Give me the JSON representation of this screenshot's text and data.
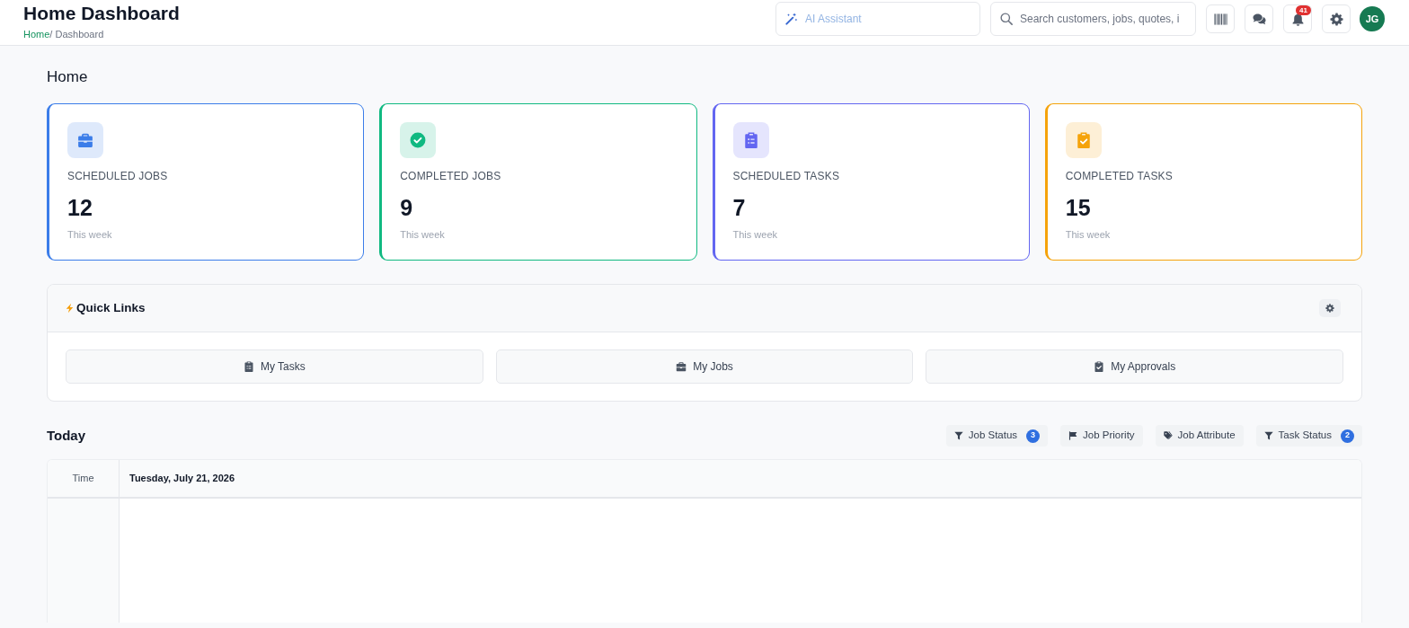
{
  "header": {
    "title": "Home Dashboard",
    "breadcrumb": {
      "link": "Home",
      "current": "/ Dashboard"
    },
    "ai_assistant": {
      "placeholder": "AI Assistant"
    },
    "search": {
      "placeholder": "Search customers, jobs, quotes, i"
    },
    "toolbar_buttons": [
      {
        "kind": "barcode"
      },
      {
        "kind": "chat"
      },
      {
        "kind": "bell",
        "count": "41"
      },
      {
        "kind": "settings"
      }
    ],
    "avatar": {
      "initials": "JG"
    }
  },
  "page_title": "Home",
  "stats": [
    {
      "kind": "briefcase",
      "label": "SCHEDULED JOBS",
      "value": "12",
      "note": "This week",
      "color": "#3b7de9"
    },
    {
      "kind": "check-circle",
      "label": "COMPLETED JOBS",
      "value": "9",
      "note": "This week",
      "color": "#10b981"
    },
    {
      "kind": "clipboard-list",
      "label": "SCHEDULED TASKS",
      "value": "7",
      "note": "This week",
      "color": "#6366f1"
    },
    {
      "kind": "clipboard-check",
      "label": "COMPLETED TASKS",
      "value": "15",
      "note": "This week",
      "color": "#f5a30b"
    }
  ],
  "quick_links": {
    "title": "Quick Links",
    "links": [
      {
        "kind": "clipboard-list",
        "label": "My Tasks"
      },
      {
        "kind": "briefcase",
        "label": "My Jobs"
      },
      {
        "kind": "clipboard-check",
        "label": "My Approvals"
      }
    ]
  },
  "today": {
    "title": "Today",
    "filters": [
      {
        "kind": "funnel",
        "label": "Job Status",
        "count": "3"
      },
      {
        "kind": "flag",
        "label": "Job Priority"
      },
      {
        "kind": "tags",
        "label": "Job Attribute"
      },
      {
        "kind": "funnel",
        "label": "Task Status",
        "count": "2"
      }
    ],
    "calendar": {
      "columns": [
        "Time",
        "Tuesday, July 21, 2026"
      ]
    }
  }
}
